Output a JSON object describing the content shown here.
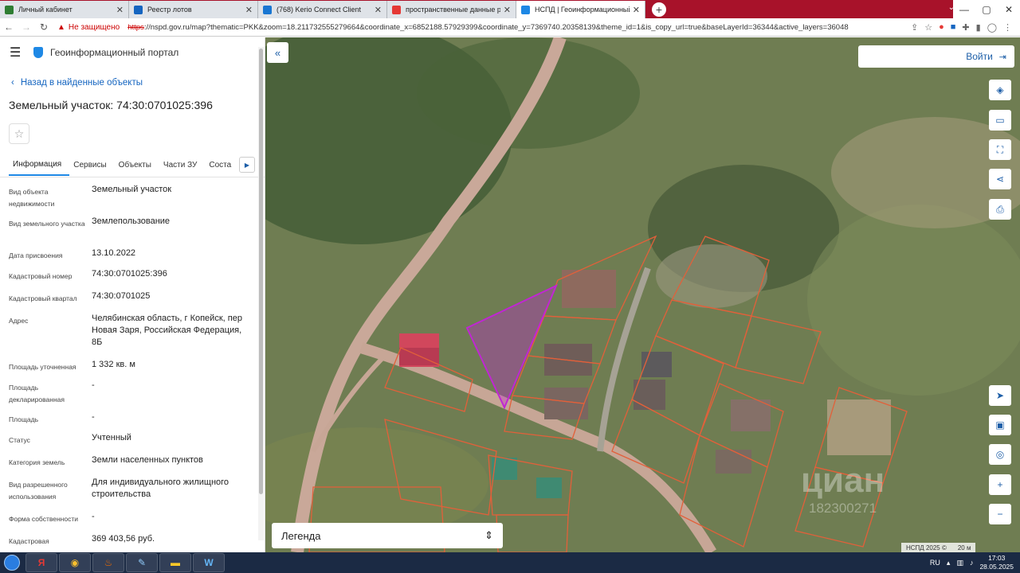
{
  "browser": {
    "tabs": [
      {
        "title": "Личный кабинет",
        "color": "#2e7d32"
      },
      {
        "title": "Реестр лотов",
        "color": "#1565c0"
      },
      {
        "title": "(768) Kerio Connect Client",
        "color": "#1976d2"
      },
      {
        "title": "пространственные данные рос",
        "color": "#e53935"
      },
      {
        "title": "НСПД | Геоинформационный п",
        "color": "#1e88e5"
      }
    ],
    "new_tab": "+",
    "warning": "Не защищено",
    "url_proto": "https",
    "url_rest": "://nspd.gov.ru/map?thematic=PKK&zoom=18.211732555279664&coordinate_x=6852188.57929399&coordinate_y=7369740.20358139&theme_id=1&is_copy_url=true&baseLayerId=36344&active_layers=36048"
  },
  "panel": {
    "portal_title": "Геоинформационный портал",
    "back_link": "Назад в найденные объекты",
    "object_title": "Земельный участок: 74:30:0701025:396",
    "tabs": [
      "Информация",
      "Сервисы",
      "Объекты",
      "Части ЗУ",
      "Соста"
    ],
    "attributes": [
      {
        "k": "Вид объекта недвижимости",
        "v": "Земельный участок"
      },
      {
        "k": "Вид земельного участка",
        "v": "Землепользование"
      },
      {
        "k": "Дата присвоения",
        "v": "13.10.2022"
      },
      {
        "k": "Кадастровый номер",
        "v": "74:30:0701025:396"
      },
      {
        "k": "Кадастровый квартал",
        "v": "74:30:0701025"
      },
      {
        "k": "Адрес",
        "v": "Челябинская область, г Копейск, пер Новая Заря, Российская Федерация, 8Б"
      },
      {
        "k": "Площадь уточненная",
        "v": "1 332 кв. м"
      },
      {
        "k": "Площадь декларированная",
        "v": "-"
      },
      {
        "k": "Площадь",
        "v": "-"
      },
      {
        "k": "Статус",
        "v": "Учтенный"
      },
      {
        "k": "Категория земель",
        "v": "Земли населенных пунктов"
      },
      {
        "k": "Вид разрешенного использования",
        "v": "Для индивидуального жилищного строительства"
      },
      {
        "k": "Форма собственности",
        "v": "-"
      },
      {
        "k": "Кадастровая",
        "v": "369 403,56 руб."
      }
    ]
  },
  "map": {
    "login_label": "Войти",
    "legend_label": "Легенда",
    "attribution": "НСПД 2025 ©",
    "scale": "20 м",
    "watermark": "циан",
    "watermark_sub": "182300271",
    "selected_color": "#c026d3",
    "parcel_color": "#e2603a"
  },
  "taskbar": {
    "lang": "RU",
    "time": "17:03",
    "date": "28.05.2025"
  }
}
